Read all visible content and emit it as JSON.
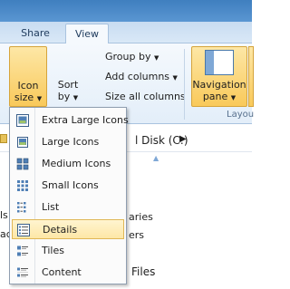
{
  "ribbon": {
    "tabs": [
      "Share",
      "View"
    ],
    "icon_size_label": "Icon",
    "icon_size_label2": "size",
    "sort_by_label": "Sort",
    "sort_by_label2": "by",
    "group_by": "Group by",
    "add_columns": "Add columns",
    "size_all_columns": "Size all columns",
    "navigation_pane_label": "Navigation",
    "navigation_pane_label2": "pane",
    "layout_group_label": "Layou"
  },
  "address": {
    "path_fragment": "l Disk (C:)"
  },
  "content_fragments": {
    "row1": "aries",
    "row2": "ers",
    "row3": "Files",
    "left1": "ls",
    "left2": "ac"
  },
  "icon_size_menu": {
    "items": [
      {
        "label": "Extra Large Icons",
        "icon": "extra-large-icons-icon",
        "selected": false
      },
      {
        "label": "Large Icons",
        "icon": "large-icons-icon",
        "selected": false
      },
      {
        "label": "Medium Icons",
        "icon": "medium-icons-icon",
        "selected": false
      },
      {
        "label": "Small Icons",
        "icon": "small-icons-icon",
        "selected": false
      },
      {
        "label": "List",
        "icon": "list-view-icon",
        "selected": false
      },
      {
        "label": "Details",
        "icon": "details-view-icon",
        "selected": true
      },
      {
        "label": "Tiles",
        "icon": "tiles-view-icon",
        "selected": false
      },
      {
        "label": "Content",
        "icon": "content-view-icon",
        "selected": false
      }
    ]
  },
  "colors": {
    "selected_bg": "#fde7a6",
    "selected_border": "#e0b756",
    "ribbon_active": "#f9c95a"
  }
}
